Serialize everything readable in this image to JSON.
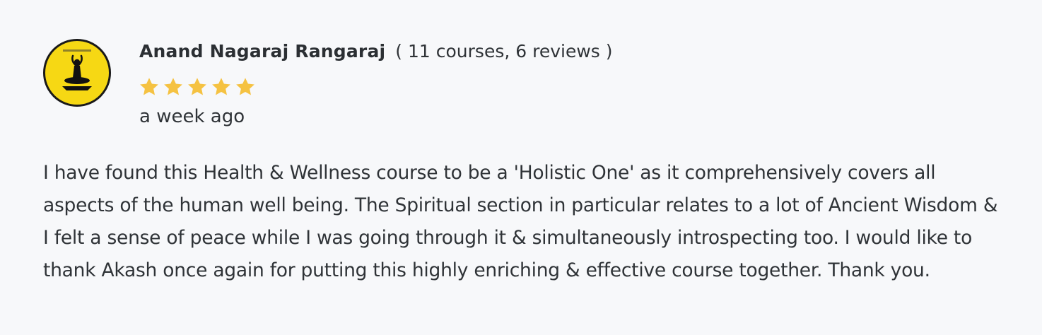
{
  "review": {
    "author": "Anand Nagaraj Rangaraj",
    "author_meta": "( 11 courses, 6 reviews )",
    "rating": 5,
    "rating_max": 5,
    "star_color": "#f5c242",
    "time_ago": "a week ago",
    "text": "I have found this Health & Wellness course to be a 'Holistic One' as it comprehensively covers all aspects of the human well being. The Spiritual section in particular relates to a lot of Ancient Wisdom & I felt a sense of peace while I was going through it & simultaneously introspecting too. I would like to thank Akash once again for putting this highly enriching & effective course together. Thank you.",
    "avatar": {
      "icon": "meditation-icon",
      "background_color": "#f6d814"
    }
  }
}
